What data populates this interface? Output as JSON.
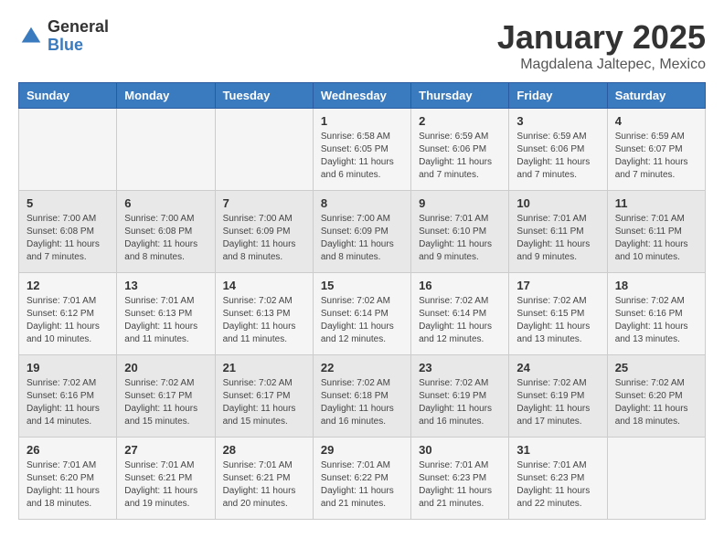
{
  "header": {
    "logo_general": "General",
    "logo_blue": "Blue",
    "month_year": "January 2025",
    "location": "Magdalena Jaltepec, Mexico"
  },
  "days_of_week": [
    "Sunday",
    "Monday",
    "Tuesday",
    "Wednesday",
    "Thursday",
    "Friday",
    "Saturday"
  ],
  "weeks": [
    [
      {
        "day": "",
        "content": ""
      },
      {
        "day": "",
        "content": ""
      },
      {
        "day": "",
        "content": ""
      },
      {
        "day": "1",
        "content": "Sunrise: 6:58 AM\nSunset: 6:05 PM\nDaylight: 11 hours and 6 minutes."
      },
      {
        "day": "2",
        "content": "Sunrise: 6:59 AM\nSunset: 6:06 PM\nDaylight: 11 hours and 7 minutes."
      },
      {
        "day": "3",
        "content": "Sunrise: 6:59 AM\nSunset: 6:06 PM\nDaylight: 11 hours and 7 minutes."
      },
      {
        "day": "4",
        "content": "Sunrise: 6:59 AM\nSunset: 6:07 PM\nDaylight: 11 hours and 7 minutes."
      }
    ],
    [
      {
        "day": "5",
        "content": "Sunrise: 7:00 AM\nSunset: 6:08 PM\nDaylight: 11 hours and 7 minutes."
      },
      {
        "day": "6",
        "content": "Sunrise: 7:00 AM\nSunset: 6:08 PM\nDaylight: 11 hours and 8 minutes."
      },
      {
        "day": "7",
        "content": "Sunrise: 7:00 AM\nSunset: 6:09 PM\nDaylight: 11 hours and 8 minutes."
      },
      {
        "day": "8",
        "content": "Sunrise: 7:00 AM\nSunset: 6:09 PM\nDaylight: 11 hours and 8 minutes."
      },
      {
        "day": "9",
        "content": "Sunrise: 7:01 AM\nSunset: 6:10 PM\nDaylight: 11 hours and 9 minutes."
      },
      {
        "day": "10",
        "content": "Sunrise: 7:01 AM\nSunset: 6:11 PM\nDaylight: 11 hours and 9 minutes."
      },
      {
        "day": "11",
        "content": "Sunrise: 7:01 AM\nSunset: 6:11 PM\nDaylight: 11 hours and 10 minutes."
      }
    ],
    [
      {
        "day": "12",
        "content": "Sunrise: 7:01 AM\nSunset: 6:12 PM\nDaylight: 11 hours and 10 minutes."
      },
      {
        "day": "13",
        "content": "Sunrise: 7:01 AM\nSunset: 6:13 PM\nDaylight: 11 hours and 11 minutes."
      },
      {
        "day": "14",
        "content": "Sunrise: 7:02 AM\nSunset: 6:13 PM\nDaylight: 11 hours and 11 minutes."
      },
      {
        "day": "15",
        "content": "Sunrise: 7:02 AM\nSunset: 6:14 PM\nDaylight: 11 hours and 12 minutes."
      },
      {
        "day": "16",
        "content": "Sunrise: 7:02 AM\nSunset: 6:14 PM\nDaylight: 11 hours and 12 minutes."
      },
      {
        "day": "17",
        "content": "Sunrise: 7:02 AM\nSunset: 6:15 PM\nDaylight: 11 hours and 13 minutes."
      },
      {
        "day": "18",
        "content": "Sunrise: 7:02 AM\nSunset: 6:16 PM\nDaylight: 11 hours and 13 minutes."
      }
    ],
    [
      {
        "day": "19",
        "content": "Sunrise: 7:02 AM\nSunset: 6:16 PM\nDaylight: 11 hours and 14 minutes."
      },
      {
        "day": "20",
        "content": "Sunrise: 7:02 AM\nSunset: 6:17 PM\nDaylight: 11 hours and 15 minutes."
      },
      {
        "day": "21",
        "content": "Sunrise: 7:02 AM\nSunset: 6:17 PM\nDaylight: 11 hours and 15 minutes."
      },
      {
        "day": "22",
        "content": "Sunrise: 7:02 AM\nSunset: 6:18 PM\nDaylight: 11 hours and 16 minutes."
      },
      {
        "day": "23",
        "content": "Sunrise: 7:02 AM\nSunset: 6:19 PM\nDaylight: 11 hours and 16 minutes."
      },
      {
        "day": "24",
        "content": "Sunrise: 7:02 AM\nSunset: 6:19 PM\nDaylight: 11 hours and 17 minutes."
      },
      {
        "day": "25",
        "content": "Sunrise: 7:02 AM\nSunset: 6:20 PM\nDaylight: 11 hours and 18 minutes."
      }
    ],
    [
      {
        "day": "26",
        "content": "Sunrise: 7:01 AM\nSunset: 6:20 PM\nDaylight: 11 hours and 18 minutes."
      },
      {
        "day": "27",
        "content": "Sunrise: 7:01 AM\nSunset: 6:21 PM\nDaylight: 11 hours and 19 minutes."
      },
      {
        "day": "28",
        "content": "Sunrise: 7:01 AM\nSunset: 6:21 PM\nDaylight: 11 hours and 20 minutes."
      },
      {
        "day": "29",
        "content": "Sunrise: 7:01 AM\nSunset: 6:22 PM\nDaylight: 11 hours and 21 minutes."
      },
      {
        "day": "30",
        "content": "Sunrise: 7:01 AM\nSunset: 6:23 PM\nDaylight: 11 hours and 21 minutes."
      },
      {
        "day": "31",
        "content": "Sunrise: 7:01 AM\nSunset: 6:23 PM\nDaylight: 11 hours and 22 minutes."
      },
      {
        "day": "",
        "content": ""
      }
    ]
  ]
}
